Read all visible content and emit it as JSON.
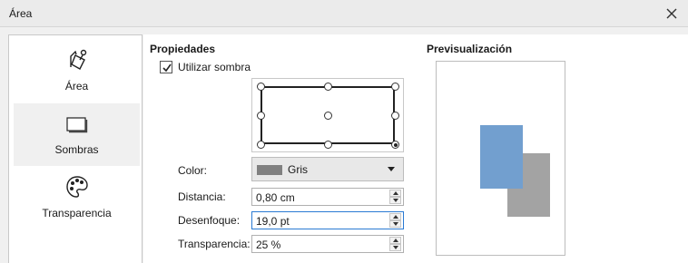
{
  "window": {
    "title": "Área"
  },
  "sidebar": {
    "items": [
      {
        "label": "Área",
        "icon": "paint-bucket-icon"
      },
      {
        "label": "Sombras",
        "icon": "shadow-box-icon"
      },
      {
        "label": "Transparencia",
        "icon": "palette-icon"
      }
    ],
    "selected": "Sombras"
  },
  "properties": {
    "title": "Propiedades",
    "use_shadow_label": "Utilizar sombra",
    "use_shadow_checked": true,
    "shadow_position_selected": "bottom-right",
    "color_label": "Color:",
    "color_value": "Gris",
    "color_swatch": "#808080",
    "distance_label": "Distancia:",
    "distance_value": "0,80 cm",
    "blur_label": "Desenfoque:",
    "blur_value": "19,0 pt",
    "transparency_label": "Transparencia:",
    "transparency_value": "25 %"
  },
  "preview": {
    "title": "Previsualización",
    "object_color": "#729fcf",
    "shadow_color": "#a3a3a3"
  }
}
